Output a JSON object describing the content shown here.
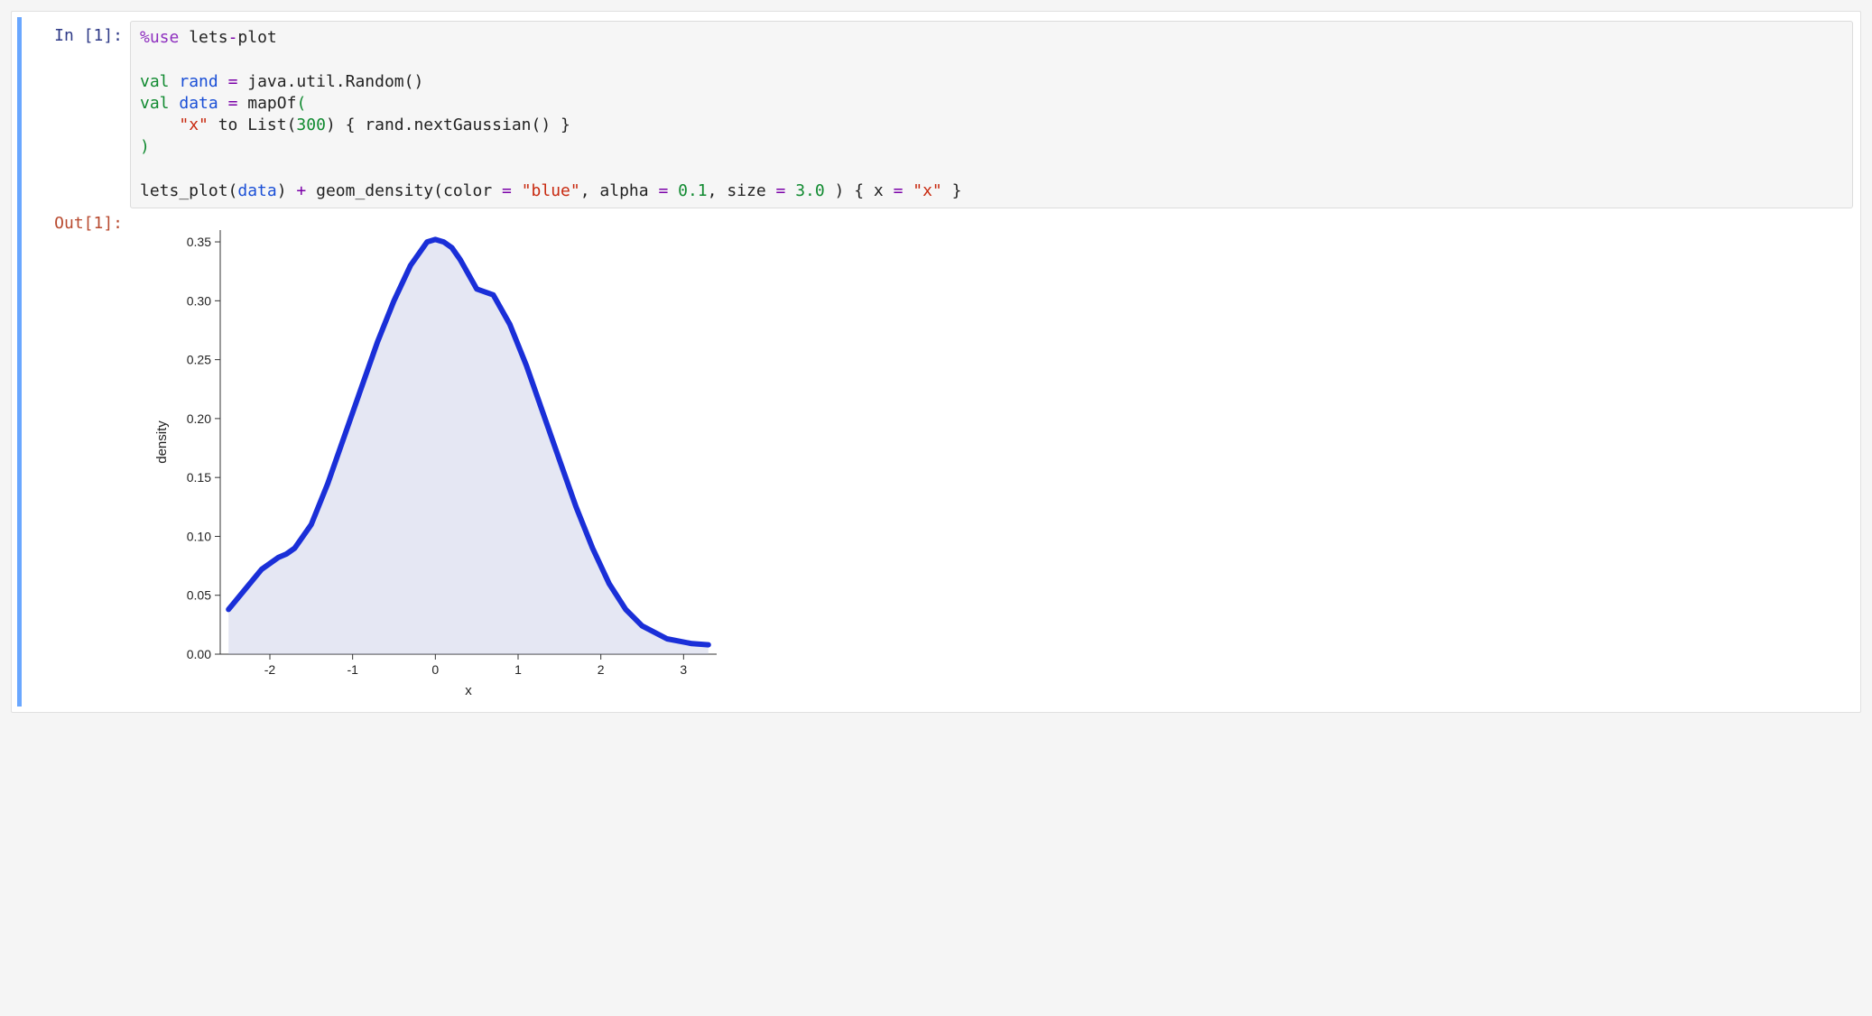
{
  "prompts": {
    "in": "In [1]:",
    "out": "Out[1]:"
  },
  "code": {
    "l1_magic": "%use",
    "l1_pkg_a": "lets",
    "l1_dash": "-",
    "l1_pkg_b": "plot",
    "l3_kw": "val",
    "l3_name": "rand",
    "l3_eq": "=",
    "l3_rhs": "java.util.Random()",
    "l4_kw": "val",
    "l4_name": "data",
    "l4_eq": "=",
    "l4_fn": "mapOf",
    "l4_paren": "(",
    "l5_indent": "    ",
    "l5_str": "\"x\"",
    "l5_to": " to List(",
    "l5_num": "300",
    "l5_rest": ") { rand.nextGaussian() }",
    "l6_paren": ")",
    "l8_a": "lets_plot(",
    "l8_data": "data",
    "l8_b": ") ",
    "l8_plus": "+",
    "l8_c": " geom_density(color ",
    "l8_eq1": "=",
    "l8_d": " ",
    "l8_blue": "\"blue\"",
    "l8_e": ", alpha ",
    "l8_eq2": "=",
    "l8_f": " ",
    "l8_alpha": "0.1",
    "l8_g": ", size ",
    "l8_eq3": "=",
    "l8_h": " ",
    "l8_size": "3.0",
    "l8_i": " ) { x ",
    "l8_eq4": "=",
    "l8_j": " ",
    "l8_xstr": "\"x\"",
    "l8_k": " }"
  },
  "chart_data": {
    "type": "area",
    "title": "",
    "xlabel": "x",
    "ylabel": "density",
    "xlim": [
      -2.6,
      3.4
    ],
    "ylim": [
      0.0,
      0.36
    ],
    "xticks": [
      -2,
      -1,
      0,
      1,
      2,
      3
    ],
    "yticks": [
      0.0,
      0.05,
      0.1,
      0.15,
      0.2,
      0.25,
      0.3,
      0.35
    ],
    "ytick_labels": [
      "0.00",
      "0.05",
      "0.10",
      "0.15",
      "0.20",
      "0.25",
      "0.30",
      "0.35"
    ],
    "series": [
      {
        "name": "density",
        "color": "#1a2fd8",
        "fill_alpha": 0.1,
        "x": [
          -2.5,
          -2.3,
          -2.1,
          -1.9,
          -1.8,
          -1.7,
          -1.5,
          -1.3,
          -1.1,
          -0.9,
          -0.7,
          -0.5,
          -0.3,
          -0.1,
          0.0,
          0.1,
          0.2,
          0.3,
          0.5,
          0.7,
          0.9,
          1.1,
          1.3,
          1.5,
          1.7,
          1.9,
          2.1,
          2.3,
          2.5,
          2.8,
          3.1,
          3.3
        ],
        "y": [
          0.038,
          0.055,
          0.072,
          0.082,
          0.085,
          0.09,
          0.11,
          0.145,
          0.185,
          0.225,
          0.265,
          0.3,
          0.33,
          0.35,
          0.352,
          0.35,
          0.345,
          0.335,
          0.31,
          0.305,
          0.28,
          0.245,
          0.205,
          0.165,
          0.125,
          0.09,
          0.06,
          0.038,
          0.024,
          0.013,
          0.009,
          0.008
        ]
      }
    ]
  }
}
